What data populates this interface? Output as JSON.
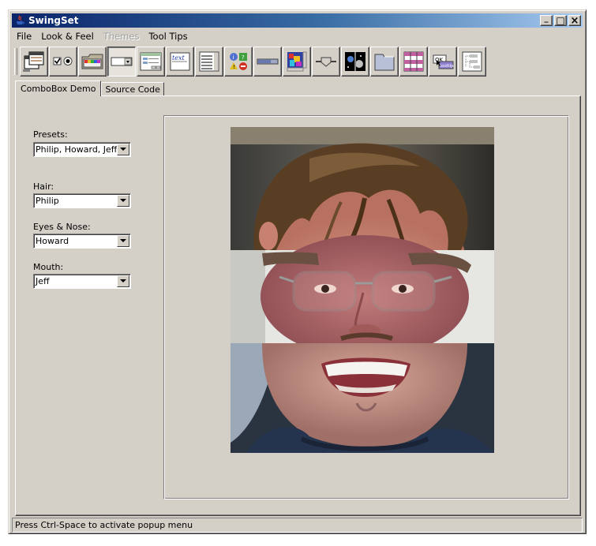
{
  "window": {
    "title": "SwingSet",
    "minimize_glyph": "_",
    "maximize_glyph": "□",
    "close_glyph": "×"
  },
  "menubar": {
    "items": [
      {
        "label": "File",
        "enabled": true
      },
      {
        "label": "Look & Feel",
        "enabled": true
      },
      {
        "label": "Themes",
        "enabled": false
      },
      {
        "label": "Tool Tips",
        "enabled": true
      }
    ]
  },
  "toolbar": {
    "buttons": [
      {
        "name": "internal-frame-demo-icon"
      },
      {
        "name": "checkbox-radio-demo-icon"
      },
      {
        "name": "color-chooser-demo-icon"
      },
      {
        "name": "combobox-demo-icon",
        "selected": true
      },
      {
        "name": "file-chooser-demo-icon"
      },
      {
        "name": "html-editor-demo-icon"
      },
      {
        "name": "list-demo-icon"
      },
      {
        "name": "option-pane-demo-icon"
      },
      {
        "name": "progress-bar-demo-icon"
      },
      {
        "name": "scroll-pane-demo-icon"
      },
      {
        "name": "slider-demo-icon"
      },
      {
        "name": "split-pane-demo-icon"
      },
      {
        "name": "tabbed-pane-demo-icon"
      },
      {
        "name": "table-demo-icon"
      },
      {
        "name": "tooltip-demo-icon"
      },
      {
        "name": "tree-demo-icon"
      }
    ],
    "tooltip_icon_text": "OK",
    "tooltip_icon_text2": "tooltip",
    "text_icon_text": "text"
  },
  "tabs": [
    {
      "label": "ComboBox Demo",
      "active": true
    },
    {
      "label": "Source Code",
      "active": false
    }
  ],
  "combos": {
    "presets": {
      "label": "Presets:",
      "value": "Philip, Howard, Jeff"
    },
    "hair": {
      "label": "Hair:",
      "value": "Philip"
    },
    "eyes": {
      "label": "Eyes & Nose:",
      "value": "Howard"
    },
    "mouth": {
      "label": "Mouth:",
      "value": "Jeff"
    }
  },
  "status": {
    "text": "Press Ctrl-Space to activate popup menu"
  }
}
